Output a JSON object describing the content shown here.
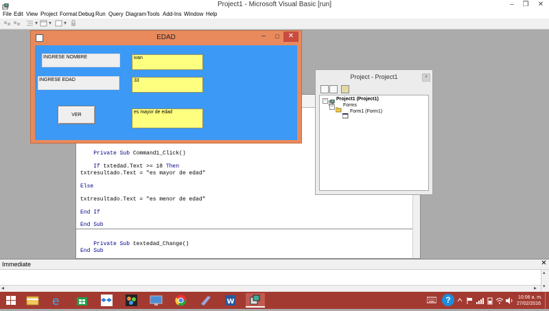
{
  "app": {
    "title": "Project1 - Microsoft Visual Basic [run]",
    "minimize_glyph": "–",
    "restore_glyph": "❐",
    "close_glyph": "✕"
  },
  "menu": [
    "File",
    "Edit",
    "View",
    "Project",
    "Format",
    "Debug",
    "Run",
    "Query",
    "Diagram",
    "Tools",
    "Add-Ins",
    "Window",
    "Help"
  ],
  "toolbar": {
    "icons": [
      "toggle-folders-icon",
      "view-object-icon",
      "indent-icon",
      "add-form-icon",
      "add-module-icon",
      "lock-icon"
    ],
    "dropdown_glyph": "▾"
  },
  "form": {
    "title": "EDAD",
    "minimize_glyph": "–",
    "maximize_glyph": "□",
    "close_glyph": "✕",
    "label_nombre": "INGRESE NOMBRE",
    "label_edad": "INGRESE EDAD",
    "txt_nombre": "ivan",
    "txt_edad": "33",
    "txt_resultado": "es mayor de edad",
    "button": "VER",
    "client_color": "#3c99f5",
    "textbox_color": "#ffff7f"
  },
  "code": {
    "sub1_decl": "Private Sub Command1_Click()",
    "if_kw": "If",
    "if_cond": " txtedad.Text >= 18 ",
    "then_kw": "Then",
    "line_major": "txtresultado.Text = \"es mayor de edad\"",
    "else_kw": "Else",
    "line_minor": "txtresultado.Text = \"es menor de edad\"",
    "endif_kw": "End If",
    "endsub1": "End Sub",
    "sub2_decl": "Private Sub textedad_Change()",
    "endsub2": "End Sub"
  },
  "project": {
    "title": "Project - Project1",
    "close_glyph": "x",
    "root": "Project1 (Project1)",
    "folder": "Forms",
    "item": "Form1 (Form1)",
    "expand_glyph": "–"
  },
  "immediate": {
    "title": "Immediate",
    "close_glyph": "✕",
    "scroll_left": "◂",
    "scroll_right": "▸",
    "scroll_up": "▴",
    "scroll_down": "▾"
  },
  "taskbar": {
    "apps": [
      "file-explorer-icon",
      "internet-explorer-icon",
      "store-icon",
      "dropbox-icon",
      "photos-icon",
      "remote-desktop-icon",
      "chrome-icon",
      "notepad-icon",
      "word-icon",
      "visual-basic-icon"
    ],
    "time": "10:06 a. m.",
    "date": "27/02/2016",
    "help_glyph": "?",
    "accent": "#a33a31"
  }
}
